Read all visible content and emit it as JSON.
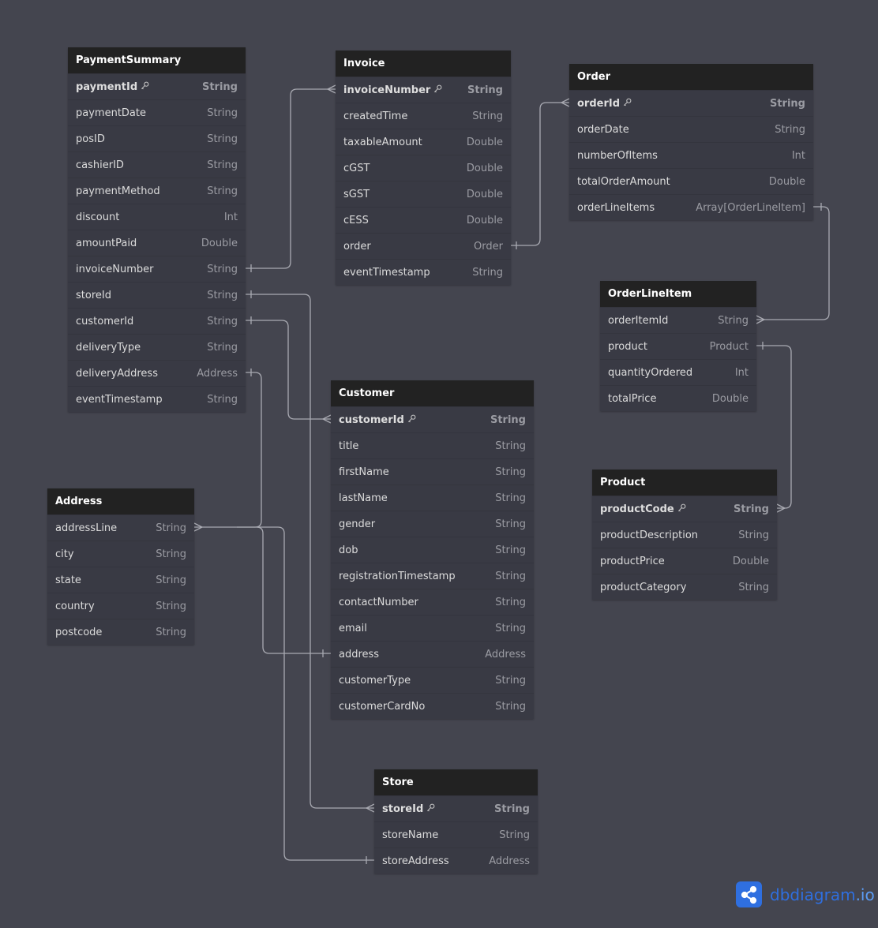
{
  "brand": {
    "name": "dbdiagram",
    "suffix": ".io",
    "logo_icon": "share-nodes-icon"
  },
  "tables": [
    {
      "id": "PaymentSummary",
      "title": "PaymentSummary",
      "fields": [
        {
          "name": "paymentId",
          "type": "String",
          "pk": true
        },
        {
          "name": "paymentDate",
          "type": "String"
        },
        {
          "name": "posID",
          "type": "String"
        },
        {
          "name": "cashierID",
          "type": "String"
        },
        {
          "name": "paymentMethod",
          "type": "String"
        },
        {
          "name": "discount",
          "type": "Int"
        },
        {
          "name": "amountPaid",
          "type": "Double"
        },
        {
          "name": "invoiceNumber",
          "type": "String"
        },
        {
          "name": "storeId",
          "type": "String"
        },
        {
          "name": "customerId",
          "type": "String"
        },
        {
          "name": "deliveryType",
          "type": "String"
        },
        {
          "name": "deliveryAddress",
          "type": "Address"
        },
        {
          "name": "eventTimestamp",
          "type": "String"
        }
      ]
    },
    {
      "id": "Invoice",
      "title": "Invoice",
      "fields": [
        {
          "name": "invoiceNumber",
          "type": "String",
          "pk": true
        },
        {
          "name": "createdTime",
          "type": "String"
        },
        {
          "name": "taxableAmount",
          "type": "Double"
        },
        {
          "name": "cGST",
          "type": "Double"
        },
        {
          "name": "sGST",
          "type": "Double"
        },
        {
          "name": "cESS",
          "type": "Double"
        },
        {
          "name": "order",
          "type": "Order"
        },
        {
          "name": "eventTimestamp",
          "type": "String"
        }
      ]
    },
    {
      "id": "Order",
      "title": "Order",
      "fields": [
        {
          "name": "orderId",
          "type": "String",
          "pk": true
        },
        {
          "name": "orderDate",
          "type": "String"
        },
        {
          "name": "numberOfItems",
          "type": "Int"
        },
        {
          "name": "totalOrderAmount",
          "type": "Double"
        },
        {
          "name": "orderLineItems",
          "type": "Array[OrderLineItem]"
        }
      ]
    },
    {
      "id": "OrderLineItem",
      "title": "OrderLineItem",
      "fields": [
        {
          "name": "orderItemId",
          "type": "String"
        },
        {
          "name": "product",
          "type": "Product"
        },
        {
          "name": "quantityOrdered",
          "type": "Int"
        },
        {
          "name": "totalPrice",
          "type": "Double"
        }
      ]
    },
    {
      "id": "Customer",
      "title": "Customer",
      "fields": [
        {
          "name": "customerId",
          "type": "String",
          "pk": true
        },
        {
          "name": "title",
          "type": "String"
        },
        {
          "name": "firstName",
          "type": "String"
        },
        {
          "name": "lastName",
          "type": "String"
        },
        {
          "name": "gender",
          "type": "String"
        },
        {
          "name": "dob",
          "type": "String"
        },
        {
          "name": "registrationTimestamp",
          "type": "String"
        },
        {
          "name": "contactNumber",
          "type": "String"
        },
        {
          "name": "email",
          "type": "String"
        },
        {
          "name": "address",
          "type": "Address"
        },
        {
          "name": "customerType",
          "type": "String"
        },
        {
          "name": "customerCardNo",
          "type": "String"
        }
      ]
    },
    {
      "id": "Address",
      "title": "Address",
      "fields": [
        {
          "name": "addressLine",
          "type": "String"
        },
        {
          "name": "city",
          "type": "String"
        },
        {
          "name": "state",
          "type": "String"
        },
        {
          "name": "country",
          "type": "String"
        },
        {
          "name": "postcode",
          "type": "String"
        }
      ]
    },
    {
      "id": "Product",
      "title": "Product",
      "fields": [
        {
          "name": "productCode",
          "type": "String",
          "pk": true
        },
        {
          "name": "productDescription",
          "type": "String"
        },
        {
          "name": "productPrice",
          "type": "Double"
        },
        {
          "name": "productCategory",
          "type": "String"
        }
      ]
    },
    {
      "id": "Store",
      "title": "Store",
      "fields": [
        {
          "name": "storeId",
          "type": "String",
          "pk": true
        },
        {
          "name": "storeName",
          "type": "String"
        },
        {
          "name": "storeAddress",
          "type": "Address"
        }
      ]
    }
  ],
  "relationships": [
    {
      "from": "PaymentSummary.invoiceNumber",
      "to": "Invoice.invoiceNumber"
    },
    {
      "from": "Invoice.order",
      "to": "Order.orderId"
    },
    {
      "from": "Order.orderLineItems",
      "to": "OrderLineItem.orderItemId"
    },
    {
      "from": "OrderLineItem.product",
      "to": "Product.productCode"
    },
    {
      "from": "PaymentSummary.storeId",
      "to": "Store.storeId"
    },
    {
      "from": "PaymentSummary.customerId",
      "to": "Customer.customerId"
    },
    {
      "from": "PaymentSummary.deliveryAddress",
      "to": "Address.addressLine"
    },
    {
      "from": "Customer.address",
      "to": "Address.addressLine"
    },
    {
      "from": "Store.storeAddress",
      "to": "Address.addressLine"
    }
  ],
  "colors": {
    "background": "#44454f",
    "header": "#222222",
    "body": "#393a44",
    "line": "#a9aab2",
    "brand": "#2f6fe0"
  }
}
